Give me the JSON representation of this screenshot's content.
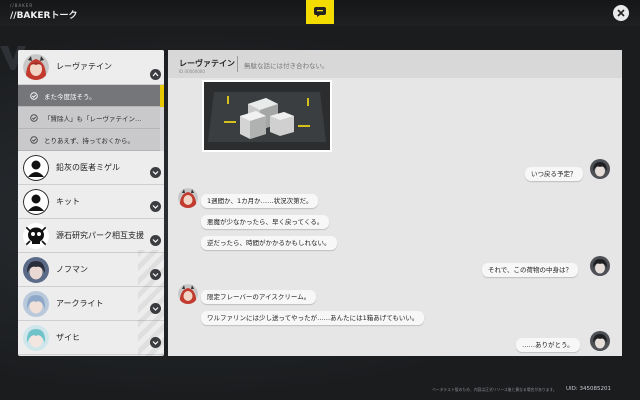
{
  "app": {
    "subtitle": "//BAKER",
    "title": "//BAKERトーク",
    "uid": "UID: 345085201",
    "footer_note": "ベータテスト版のため、内容は正式リリース後と異なる場合があります。",
    "accent_color": "#f5dc00"
  },
  "contacts": [
    {
      "name": "レーヴァテイン",
      "icon": "red-hair-avatar",
      "expanded": true
    },
    {
      "name": "鉛灰の医者ミゲル",
      "icon": "silhouette-avatar"
    },
    {
      "name": "キット",
      "icon": "silhouette-avatar"
    },
    {
      "name": "源石研究パーク相互支援",
      "icon": "skull-group-avatar"
    },
    {
      "name": "ノフマン",
      "icon": "dark-hair-avatar"
    },
    {
      "name": "アークライト",
      "icon": "blue-hair-avatar"
    },
    {
      "name": "ザイヒ",
      "icon": "teal-hair-avatar"
    }
  ],
  "reply_options": [
    {
      "text": "また今度話そう。",
      "selected": true
    },
    {
      "text": "「賢除人」も「レーヴァテイン…",
      "selected": false
    },
    {
      "text": "とりあえず、持っておくから。",
      "selected": false
    }
  ],
  "chat": {
    "contact_name": "レーヴァテイン",
    "contact_sub": "ID 00000000",
    "status": "無駄な話には付き合わない。",
    "messages": [
      {
        "side": "right",
        "text": "いつ戻る予定？"
      },
      {
        "side": "left",
        "text": "1週間か、1カ月か……状況次第だ。"
      },
      {
        "side": "left",
        "text": "悪魔が少なかったら、早く戻ってくる。"
      },
      {
        "side": "left",
        "text": "逆だったら、時間がかかるかもしれない。"
      },
      {
        "side": "right",
        "text": "それで、この荷物の中身は？"
      },
      {
        "side": "left",
        "text": "限定フレーバーのアイスクリーム。"
      },
      {
        "side": "left",
        "text": "ワルファリンには少し送ってやったが……あんたには1箱あげてもいい。"
      },
      {
        "side": "right",
        "text": "……ありがとう。"
      }
    ]
  }
}
